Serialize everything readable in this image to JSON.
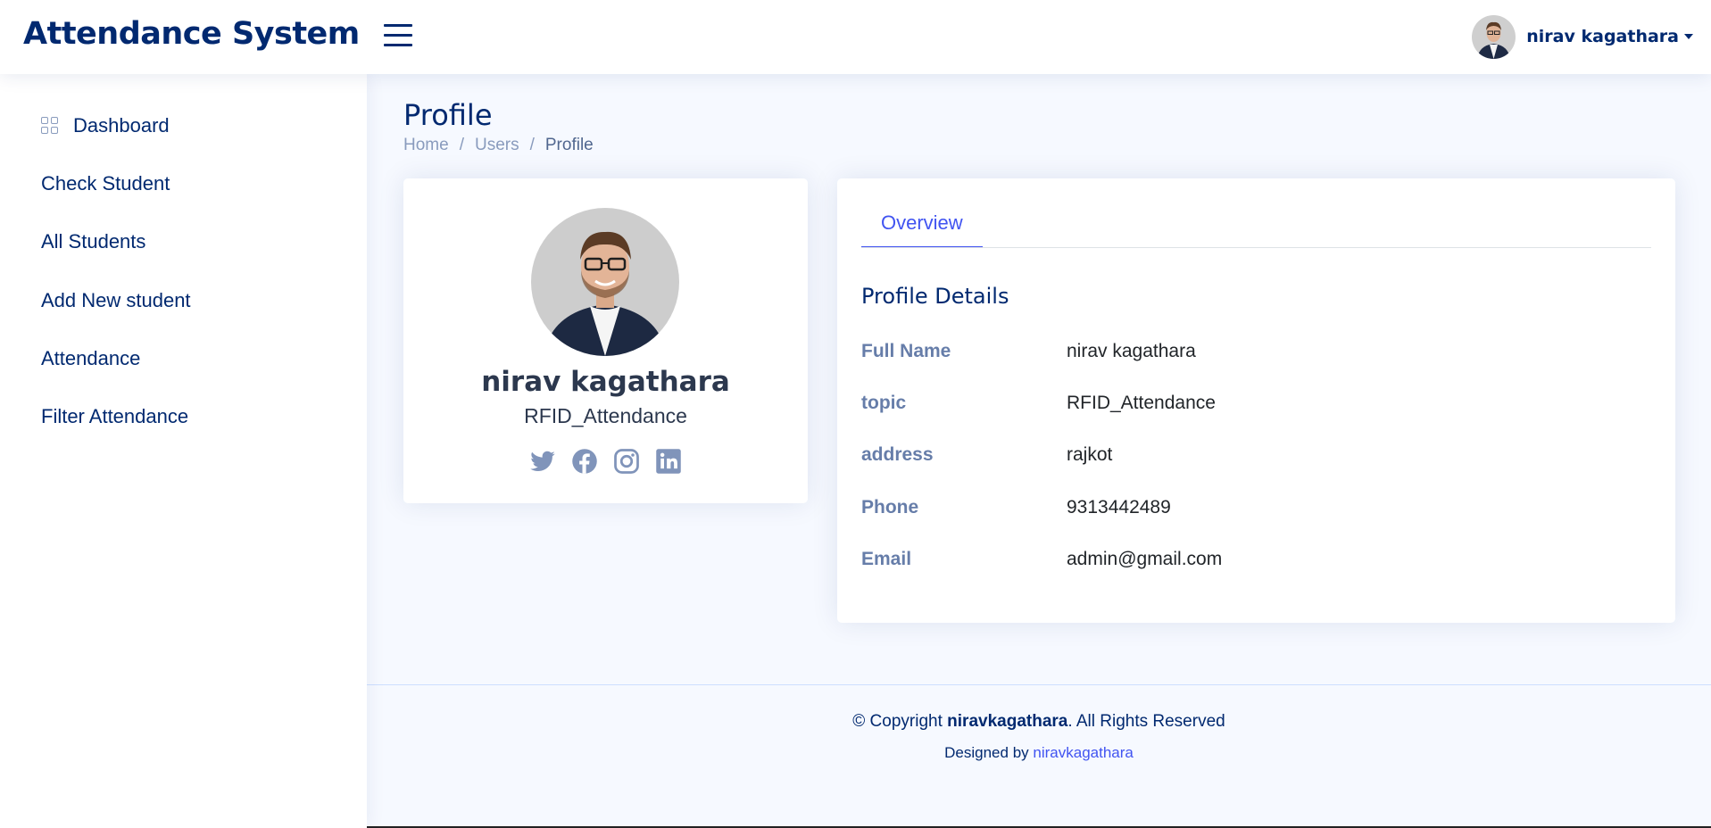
{
  "header": {
    "brand": "Attendance System",
    "user_name": "nirav kagathara"
  },
  "sidebar": {
    "items": [
      {
        "label": "Dashboard",
        "icon": "grid-icon"
      },
      {
        "label": "Check Student"
      },
      {
        "label": "All Students"
      },
      {
        "label": "Add New student"
      },
      {
        "label": "Attendance"
      },
      {
        "label": "Filter Attendance"
      }
    ]
  },
  "page": {
    "title": "Profile",
    "breadcrumb": [
      "Home",
      "Users",
      "Profile"
    ],
    "separator": "/"
  },
  "profile_card": {
    "name": "nirav kagathara",
    "subtitle": "RFID_Attendance",
    "socials": [
      "twitter-icon",
      "facebook-icon",
      "instagram-icon",
      "linkedin-icon"
    ]
  },
  "details": {
    "tab": "Overview",
    "title": "Profile Details",
    "rows": [
      {
        "label": "Full Name",
        "value": "nirav kagathara"
      },
      {
        "label": "topic",
        "value": "RFID_Attendance"
      },
      {
        "label": "address",
        "value": "rajkot"
      },
      {
        "label": "Phone",
        "value": "9313442489"
      },
      {
        "label": "Email",
        "value": "admin@gmail.com"
      }
    ]
  },
  "footer": {
    "copyright_prefix": "© Copyright",
    "copyright_owner": "niravkagathara",
    "copyright_suffix": ". All Rights Reserved",
    "designed_prefix": "Designed by",
    "designed_link": "niravkagathara"
  },
  "colors": {
    "brand": "#012970",
    "accent": "#4154f1",
    "background": "#f6f9ff"
  }
}
